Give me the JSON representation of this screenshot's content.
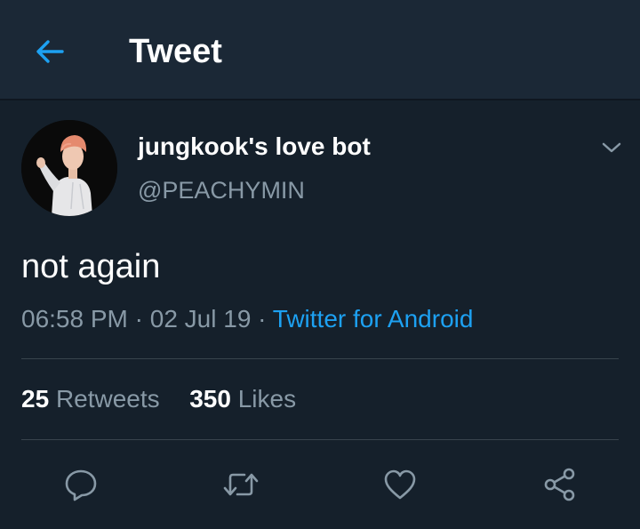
{
  "header": {
    "back_icon": "arrow-left-icon",
    "title": "Tweet"
  },
  "tweet": {
    "author": {
      "display_name": "jungkook's love bot",
      "handle": "@PEACHYMIN",
      "avatar_icon": "avatar-photo"
    },
    "menu_icon": "chevron-down-icon",
    "text": "not again",
    "time": "06:58 PM",
    "date": "02 Jul 19",
    "separator": "·",
    "source": "Twitter for Android",
    "stats": {
      "retweets_count": "25",
      "retweets_label": "Retweets",
      "likes_count": "350",
      "likes_label": "Likes"
    },
    "actions": [
      "reply-icon",
      "retweet-icon",
      "like-icon",
      "share-icon"
    ]
  },
  "colors": {
    "background": "#15202b",
    "header_background": "#1b2836",
    "accent": "#1da1f2",
    "secondary_text": "#8899a6",
    "divider": "#38444d"
  }
}
